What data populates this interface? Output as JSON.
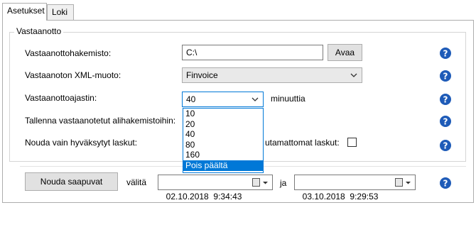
{
  "tabs": [
    {
      "label": "Asetukset",
      "active": true
    },
    {
      "label": "Loki",
      "active": false
    }
  ],
  "group": {
    "title": "Vastaanotto"
  },
  "rows": {
    "directory": {
      "label": "Vastaanottohakemisto:",
      "value": "C:\\",
      "button": "Avaa"
    },
    "xml_format": {
      "label": "Vastaanoton XML-muoto:",
      "value": "Finvoice"
    },
    "timer": {
      "label": "Vastaanottoajastin:",
      "value": "40",
      "unit": "minuuttia"
    },
    "subfolders": {
      "label": "Tallenna vastaanotetut alihakemistoihin:"
    },
    "approved_only": {
      "label": "Nouda vain hyväksytyt laskut:",
      "right_label": "utamattomat laskut:"
    }
  },
  "dropdown": {
    "options": [
      "10",
      "20",
      "40",
      "80",
      "160",
      "Pois päältä"
    ],
    "highlighted": "Pois päältä"
  },
  "bottom": {
    "button": "Nouda saapuvat",
    "between_label": "välitä",
    "from_date": "02.10.2018  9:34:43",
    "and_label": "ja",
    "to_date": "03.10.2018  9:29:53"
  },
  "icons": {
    "help": "help-question-icon",
    "chevron": "chevron-down-icon",
    "calendar": "calendar-icon"
  },
  "colors": {
    "help_blue": "#1e5bb8",
    "selection_blue": "#0078d7"
  }
}
